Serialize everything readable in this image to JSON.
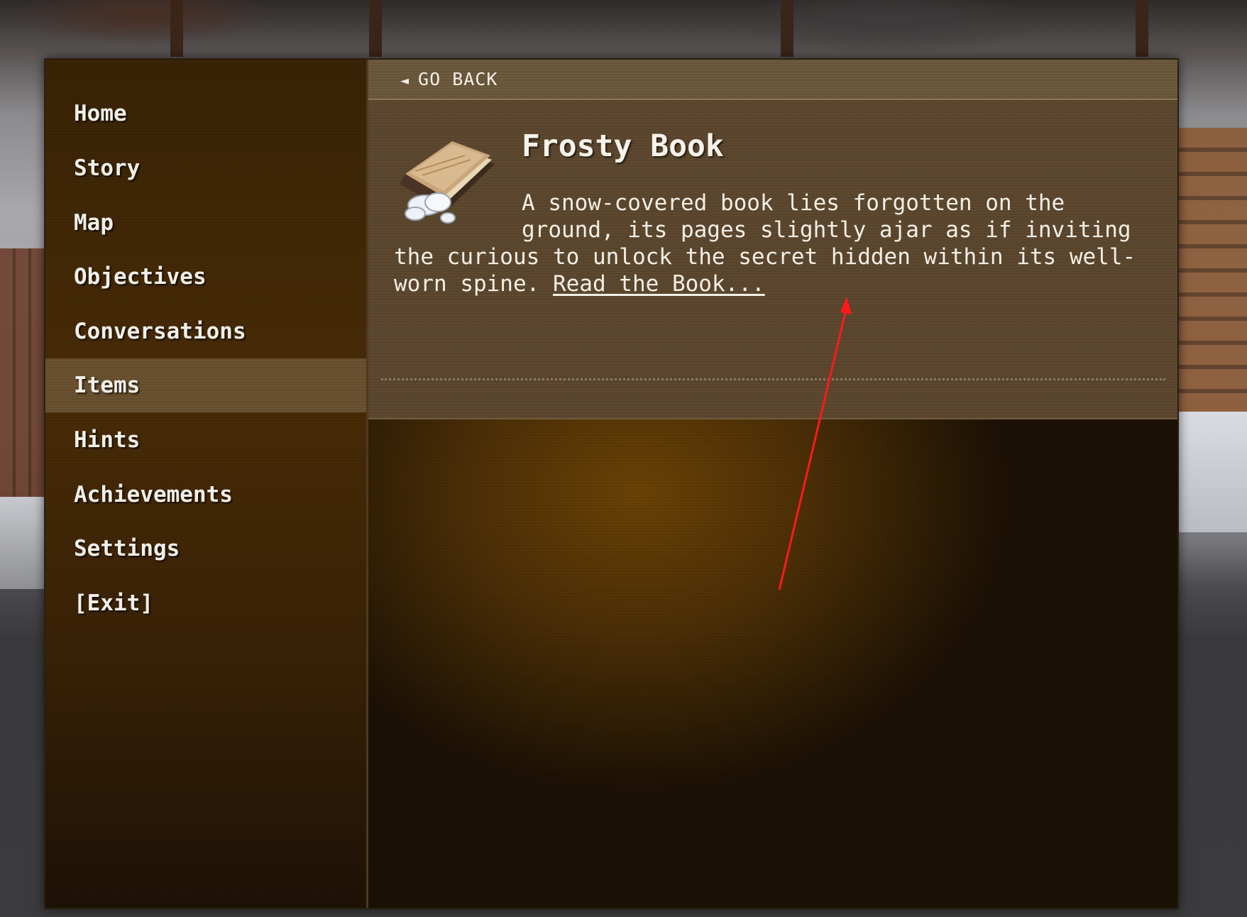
{
  "nav": {
    "items": [
      {
        "label": "Home"
      },
      {
        "label": "Story"
      },
      {
        "label": "Map"
      },
      {
        "label": "Objectives"
      },
      {
        "label": "Conversations"
      },
      {
        "label": "Items",
        "active": true
      },
      {
        "label": "Hints"
      },
      {
        "label": "Achievements"
      },
      {
        "label": "Settings"
      },
      {
        "label": "[Exit]"
      }
    ]
  },
  "header": {
    "back_arrow": "◄",
    "back_label": "GO BACK"
  },
  "item": {
    "icon": "frosty-book-icon",
    "title": "Frosty Book",
    "description": "A snow-covered book lies forgotten on the ground, its pages slightly ajar as if inviting the curious to unlock the secret hidden within its well-worn spine.",
    "link_label": "Read the Book..."
  },
  "colors": {
    "active_nav": "#6b5331",
    "annotation_arrow": "#ff1a1a"
  }
}
